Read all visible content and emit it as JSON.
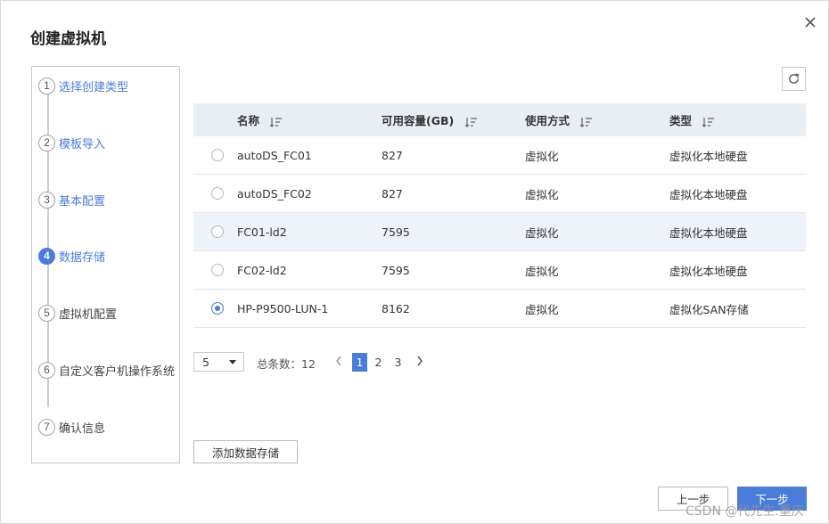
{
  "dialog": {
    "title": "创建虚拟机",
    "close_icon": "close-icon"
  },
  "steps": [
    {
      "num": "1",
      "label": "选择创建类型",
      "state": "done"
    },
    {
      "num": "2",
      "label": "模板导入",
      "state": "done"
    },
    {
      "num": "3",
      "label": "基本配置",
      "state": "done"
    },
    {
      "num": "4",
      "label": "数据存储",
      "state": "active"
    },
    {
      "num": "5",
      "label": "虚拟机配置",
      "state": "pending"
    },
    {
      "num": "6",
      "label": "自定义客户机操作系统",
      "state": "pending"
    },
    {
      "num": "7",
      "label": "确认信息",
      "state": "pending"
    }
  ],
  "toolbar": {
    "refresh_icon": "refresh-icon"
  },
  "table": {
    "headers": [
      "名称",
      "可用容量(GB)",
      "使用方式",
      "类型"
    ],
    "rows": [
      {
        "name": "autoDS_FC01",
        "capacity": "827",
        "usage": "虚拟化",
        "type": "虚拟化本地硬盘",
        "selected": false
      },
      {
        "name": "autoDS_FC02",
        "capacity": "827",
        "usage": "虚拟化",
        "type": "虚拟化本地硬盘",
        "selected": false
      },
      {
        "name": "FC01-ld2",
        "capacity": "7595",
        "usage": "虚拟化",
        "type": "虚拟化本地硬盘",
        "selected": false
      },
      {
        "name": "FC02-ld2",
        "capacity": "7595",
        "usage": "虚拟化",
        "type": "虚拟化本地硬盘",
        "selected": false
      },
      {
        "name": "HP-P9500-LUN-1",
        "capacity": "8162",
        "usage": "虚拟化",
        "type": "虚拟化SAN存储",
        "selected": true
      }
    ]
  },
  "pagination": {
    "page_size": "5",
    "total_label": "总条数：12",
    "pages": [
      "1",
      "2",
      "3"
    ],
    "current_page": "1"
  },
  "buttons": {
    "add_datastore": "添加数据存储",
    "prev": "上一步",
    "next": "下一步"
  },
  "watermark": "CSDN @代先生.重庆",
  "colors": {
    "accent": "#4a7dd9",
    "header_bg": "#e9eef5",
    "row_highlight": "#eef2f9"
  }
}
